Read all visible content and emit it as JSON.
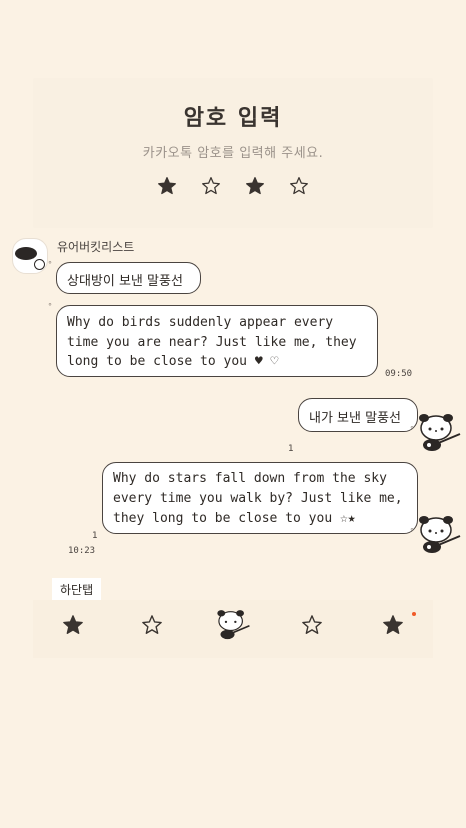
{
  "passcode": {
    "title": "암호 입력",
    "subtitle": "카카오톡 암호를 입력해 주세요.",
    "stars": [
      "filled",
      "outline",
      "filled",
      "outline"
    ]
  },
  "chat": {
    "sender_name": "유어버킷리스트",
    "received_short": "상대방이 보낸 말풍선",
    "received_long_lines": [
      "Why do birds suddenly appear every",
      "time you are near? Just like me, they",
      "long to be close to you ♥ ♡"
    ],
    "received_time": "09:50",
    "sent_short": "내가 보낸 말풍선",
    "sent_short_unread": "1",
    "sent_long_lines": [
      "Why do stars fall down from the sky",
      "every time you walk by? Just like me,",
      "they long to be close to you ☆★"
    ],
    "sent_long_unread": "1",
    "sent_time": "10:23"
  },
  "bottom_tab": {
    "label": "하단탭",
    "icons": [
      "star-filled-icon",
      "star-outline-icon",
      "mascot-icon",
      "star-outline-icon",
      "star-filled-icon"
    ]
  },
  "colors": {
    "background": "#fbf2e4",
    "bubble": "#ffffff",
    "outline": "#4a4440",
    "badge": "#f05a28"
  }
}
